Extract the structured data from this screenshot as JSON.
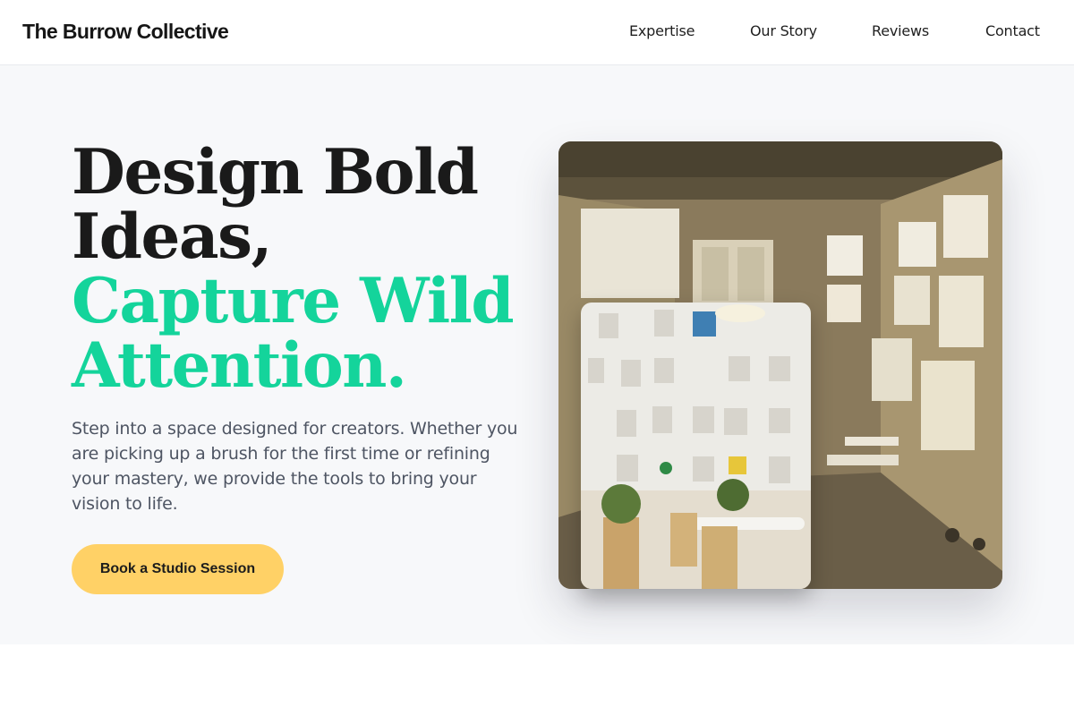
{
  "header": {
    "logo": "The Burrow Collective",
    "nav": [
      "Expertise",
      "Our Story",
      "Reviews",
      "Contact"
    ]
  },
  "hero": {
    "headline_dark": [
      "Design Bold",
      "Ideas,"
    ],
    "headline_accent": [
      "Capture Wild",
      "Attention."
    ],
    "subtext": "Step into a space designed for creators. Whether you are picking up a brush for the first time or refining your mastery, we provide the tools to bring your vision to life.",
    "cta_label": "Book a Studio Session"
  },
  "colors": {
    "accent": "#14d49b",
    "cta": "#ffd166",
    "hero_bg": "#f7f8fa",
    "heading": "#1a1a1a",
    "body_text": "#4e5563"
  }
}
